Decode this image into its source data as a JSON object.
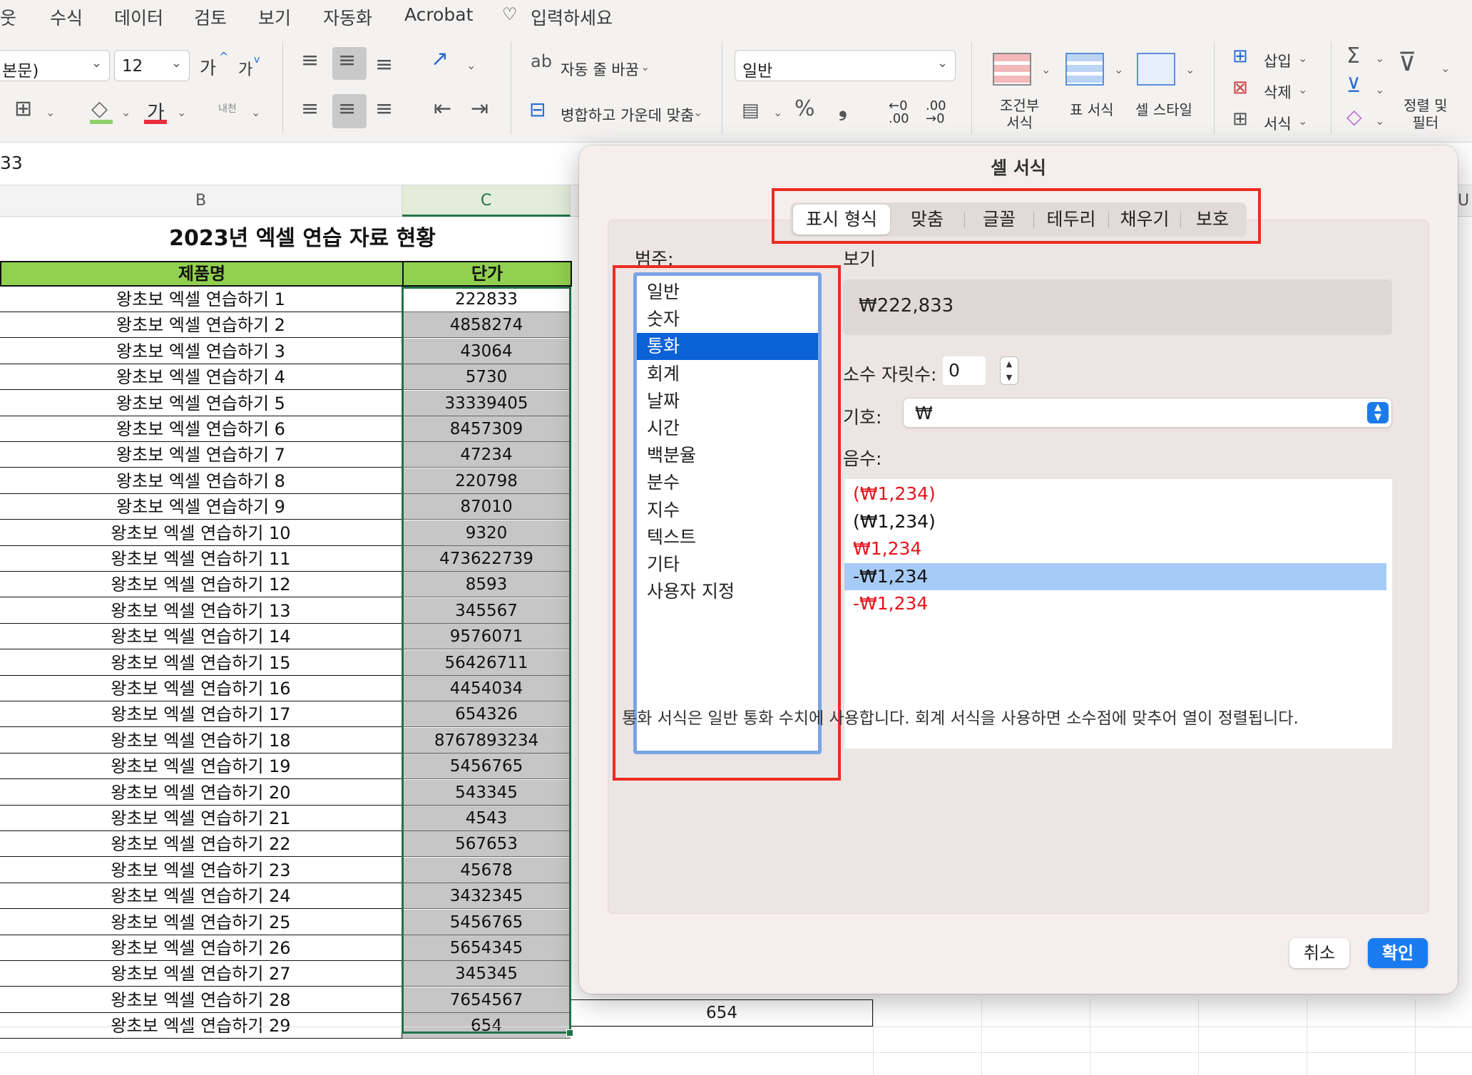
{
  "menu": [
    "웃",
    "수식",
    "데이터",
    "검토",
    "보기",
    "자동화",
    "Acrobat",
    "입력하세요"
  ],
  "ribbon": {
    "font_name": "본문)",
    "font_size": "12",
    "grow_font": "가",
    "shrink_font": "가",
    "font_color_glyph": "가",
    "orientation": "내천",
    "wrap_text": "자동 줄 바꿈",
    "merge_center": "병합하고 가운데 맞춤",
    "number_format": "일반",
    "cond_format": "조건부\n서식",
    "table_format": "표 서식",
    "cell_styles": "셀 스타일",
    "insert": "삽입",
    "delete": "삭제",
    "format": "서식",
    "sort_filter": "정렬 및\n필터"
  },
  "formula_bar": {
    "name_box": "33"
  },
  "sheet": {
    "col_b": "B",
    "col_c": "C",
    "col_u": "U",
    "title": "2023년 엑셀 연습 자료 현황",
    "header_b": "제품명",
    "header_c": "단가",
    "rows": [
      {
        "name": "왕초보 엑셀 연습하기 1",
        "price": "222833"
      },
      {
        "name": "왕초보 엑셀 연습하기 2",
        "price": "4858274"
      },
      {
        "name": "왕초보 엑셀 연습하기 3",
        "price": "43064"
      },
      {
        "name": "왕초보 엑셀 연습하기 4",
        "price": "5730"
      },
      {
        "name": "왕초보 엑셀 연습하기 5",
        "price": "33339405"
      },
      {
        "name": "왕초보 엑셀 연습하기 6",
        "price": "8457309"
      },
      {
        "name": "왕초보 엑셀 연습하기 7",
        "price": "47234"
      },
      {
        "name": "왕초보 엑셀 연습하기 8",
        "price": "220798"
      },
      {
        "name": "왕초보 엑셀 연습하기 9",
        "price": "87010"
      },
      {
        "name": "왕초보 엑셀 연습하기 10",
        "price": "9320"
      },
      {
        "name": "왕초보 엑셀 연습하기 11",
        "price": "473622739"
      },
      {
        "name": "왕초보 엑셀 연습하기 12",
        "price": "8593"
      },
      {
        "name": "왕초보 엑셀 연습하기 13",
        "price": "345567"
      },
      {
        "name": "왕초보 엑셀 연습하기 14",
        "price": "9576071"
      },
      {
        "name": "왕초보 엑셀 연습하기 15",
        "price": "56426711"
      },
      {
        "name": "왕초보 엑셀 연습하기 16",
        "price": "4454034"
      },
      {
        "name": "왕초보 엑셀 연습하기 17",
        "price": "654326"
      },
      {
        "name": "왕초보 엑셀 연습하기 18",
        "price": "8767893234"
      },
      {
        "name": "왕초보 엑셀 연습하기 19",
        "price": "5456765"
      },
      {
        "name": "왕초보 엑셀 연습하기 20",
        "price": "543345"
      },
      {
        "name": "왕초보 엑셀 연습하기 21",
        "price": "4543"
      },
      {
        "name": "왕초보 엑셀 연습하기 22",
        "price": "567653"
      },
      {
        "name": "왕초보 엑셀 연습하기 23",
        "price": "45678"
      },
      {
        "name": "왕초보 엑셀 연습하기 24",
        "price": "3432345"
      },
      {
        "name": "왕초보 엑셀 연습하기 25",
        "price": "5456765"
      },
      {
        "name": "왕초보 엑셀 연습하기 26",
        "price": "5654345"
      },
      {
        "name": "왕초보 엑셀 연습하기 27",
        "price": "345345"
      },
      {
        "name": "왕초보 엑셀 연습하기 28",
        "price": "7654567"
      },
      {
        "name": "왕초보 엑셀 연습하기 29",
        "price": "654"
      }
    ],
    "d29_value": "654"
  },
  "dialog": {
    "title": "셀 서식",
    "tabs": [
      "표시 형식",
      "맞춤",
      "글꼴",
      "테두리",
      "채우기",
      "보호"
    ],
    "active_tab": "표시 형식",
    "category_label": "범주:",
    "categories": [
      "일반",
      "숫자",
      "통화",
      "회계",
      "날짜",
      "시간",
      "백분율",
      "분수",
      "지수",
      "텍스트",
      "기타",
      "사용자 지정"
    ],
    "selected_category": "통화",
    "preview_label": "보기",
    "preview_value": "₩222,833",
    "decimal_label": "소수 자릿수:",
    "decimal_value": "0",
    "symbol_label": "기호:",
    "symbol_value": "₩",
    "negative_label": "음수:",
    "negative_options": [
      {
        "text": "(₩1,234)",
        "color": "#e8141c"
      },
      {
        "text": "(₩1,234)",
        "color": "#111111"
      },
      {
        "text": "₩1,234",
        "color": "#e8141c"
      },
      {
        "text": "-₩1,234",
        "color": "#111111"
      },
      {
        "text": "-₩1,234",
        "color": "#e8141c"
      }
    ],
    "selected_negative_index": 3,
    "description": "통화 서식은 일반 통화 수치에 사용합니다. 회계 서식을 사용하면 소수점에 맞추어 열이 정렬됩니다.",
    "cancel": "취소",
    "ok": "확인"
  },
  "colors": {
    "highlight_frame": "#ec2c22",
    "header_fill": "#92d050",
    "selection_green": "#217346",
    "primary_button": "#1a7bf0"
  }
}
